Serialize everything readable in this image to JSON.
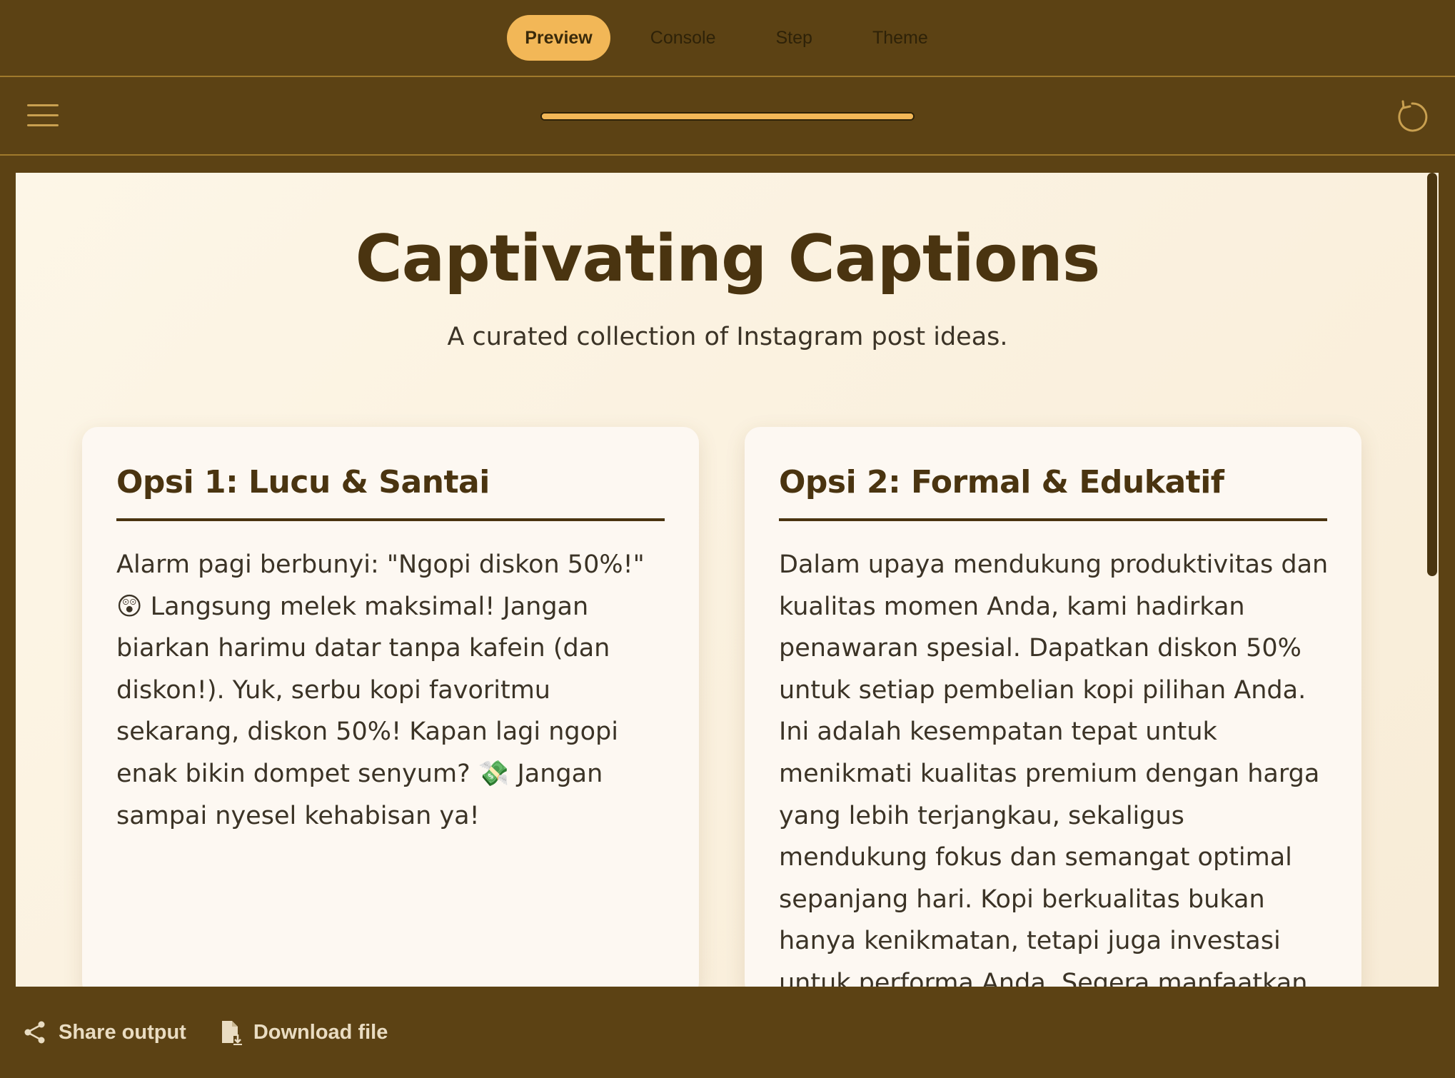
{
  "tabs": [
    {
      "label": "Preview",
      "active": true
    },
    {
      "label": "Console"
    },
    {
      "label": "Step"
    },
    {
      "label": "Theme"
    }
  ],
  "toolbar": {
    "progress_percent": 100
  },
  "page": {
    "title": "Captivating Captions",
    "subtitle": "A curated collection of Instagram post ideas."
  },
  "cards": [
    {
      "title": "Opsi 1: Lucu & Santai",
      "body": "Alarm pagi berbunyi: \"Ngopi diskon 50%!\" 😲 Langsung melek maksimal! Jangan biarkan harimu datar tanpa kafein (dan diskon!). Yuk, serbu kopi favoritmu sekarang, diskon 50%! Kapan lagi ngopi enak bikin dompet senyum? 💸 Jangan sampai nyesel kehabisan ya!"
    },
    {
      "title": "Opsi 2: Formal & Edukatif",
      "body": "Dalam upaya mendukung produktivitas dan kualitas momen Anda, kami hadirkan penawaran spesial. Dapatkan diskon 50% untuk setiap pembelian kopi pilihan Anda. Ini adalah kesempatan tepat untuk menikmati kualitas premium dengan harga yang lebih terjangkau, sekaligus mendukung fokus dan semangat optimal sepanjang hari. Kopi berkualitas bukan hanya kenikmatan, tetapi juga investasi untuk performa Anda. Segera manfaatkan promo terbatas ini."
    }
  ],
  "bottombar": {
    "share_label": "Share output",
    "download_label": "Download file"
  },
  "icons": {
    "menu": "hamburger-menu-icon",
    "reload": "reload-icon",
    "share": "share-icon",
    "download": "download-file-icon"
  },
  "colors": {
    "chrome_bg": "#5c4214",
    "accent": "#f2b757",
    "content_bg": "#fdf6e7",
    "heading": "#4a3410"
  }
}
